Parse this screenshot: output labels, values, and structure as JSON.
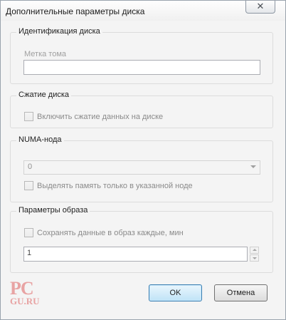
{
  "window": {
    "title": "Дополнительные параметры диска",
    "close_glyph": "✕"
  },
  "identification": {
    "caption": "Идентификация диска",
    "volume_label": "Метка тома",
    "volume_value": ""
  },
  "compression": {
    "caption": "Сжатие диска",
    "enable_label": "Включить сжатие данных на диске"
  },
  "numa": {
    "caption": "NUMA-нода",
    "node_value": "0",
    "restrict_label": "Выделять память только в указанной ноде"
  },
  "image": {
    "caption": "Параметры образа",
    "save_label": "Сохранять данные в образ каждые, мин",
    "interval_value": "1"
  },
  "buttons": {
    "ok": "OK",
    "cancel": "Отмена"
  },
  "watermark": {
    "top": "PC",
    "bottom": "GU.RU"
  }
}
